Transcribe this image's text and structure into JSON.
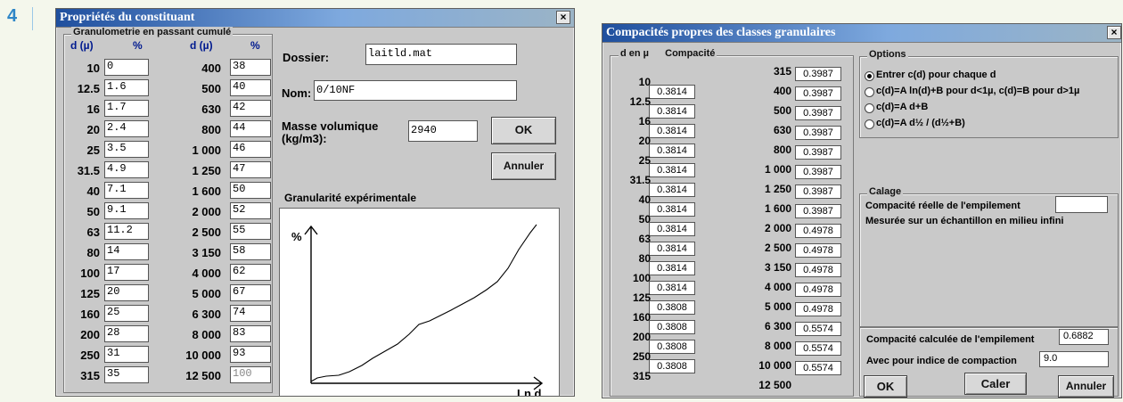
{
  "page_marker": "4",
  "left_window": {
    "title": "Propriétés du constituant",
    "close": "×",
    "group_title": "Granulometrie en passant cumulé",
    "headers": [
      "d (µ)",
      "%",
      "d (µ)",
      "%"
    ],
    "rows": [
      {
        "d1": "10",
        "p1": "0",
        "d2": "400",
        "p2": "38"
      },
      {
        "d1": "12.5",
        "p1": "1.6",
        "d2": "500",
        "p2": "40"
      },
      {
        "d1": "16",
        "p1": "1.7",
        "d2": "630",
        "p2": "42"
      },
      {
        "d1": "20",
        "p1": "2.4",
        "d2": "800",
        "p2": "44"
      },
      {
        "d1": "25",
        "p1": "3.5",
        "d2": "1 000",
        "p2": "46"
      },
      {
        "d1": "31.5",
        "p1": "4.9",
        "d2": "1 250",
        "p2": "47"
      },
      {
        "d1": "40",
        "p1": "7.1",
        "d2": "1 600",
        "p2": "50"
      },
      {
        "d1": "50",
        "p1": "9.1",
        "d2": "2 000",
        "p2": "52"
      },
      {
        "d1": "63",
        "p1": "11.2",
        "d2": "2 500",
        "p2": "55"
      },
      {
        "d1": "80",
        "p1": "14",
        "d2": "3 150",
        "p2": "58"
      },
      {
        "d1": "100",
        "p1": "17",
        "d2": "4 000",
        "p2": "62"
      },
      {
        "d1": "125",
        "p1": "20",
        "d2": "5 000",
        "p2": "67"
      },
      {
        "d1": "160",
        "p1": "25",
        "d2": "6 300",
        "p2": "74"
      },
      {
        "d1": "200",
        "p1": "28",
        "d2": "8 000",
        "p2": "83"
      },
      {
        "d1": "250",
        "p1": "31",
        "d2": "10 000",
        "p2": "93"
      },
      {
        "d1": "315",
        "p1": "35",
        "d2": "12 500",
        "p2": "100"
      }
    ],
    "folder_label": "Dossier:",
    "folder_value": "laitld.mat",
    "name_label": "Nom:",
    "name_value": "0/10NF",
    "mass_label_1": "Masse volumique",
    "mass_label_2": "(kg/m3):",
    "mass_value": "2940",
    "ok_label": "OK",
    "cancel_label": "Annuler",
    "chart_title": "Granularité expérimentale",
    "y_axis_label": "%",
    "x_axis_label": "Ln d"
  },
  "right_window": {
    "title": "Compacités propres des classes granulaires",
    "close": "×",
    "list_header_d": "d en µ",
    "list_header_c": "Compacité",
    "left_column": [
      {
        "d": "10",
        "c": "0.3814"
      },
      {
        "d": "12.5",
        "c": "0.3814"
      },
      {
        "d": "16",
        "c": "0.3814"
      },
      {
        "d": "20",
        "c": "0.3814"
      },
      {
        "d": "25",
        "c": "0.3814"
      },
      {
        "d": "31.5",
        "c": "0.3814"
      },
      {
        "d": "40",
        "c": "0.3814"
      },
      {
        "d": "50",
        "c": "0.3814"
      },
      {
        "d": "63",
        "c": "0.3814"
      },
      {
        "d": "80",
        "c": "0.3814"
      },
      {
        "d": "100",
        "c": "0.3814"
      },
      {
        "d": "125",
        "c": "0.3808"
      },
      {
        "d": "160",
        "c": "0.3808"
      },
      {
        "d": "200",
        "c": "0.3808"
      },
      {
        "d": "250",
        "c": "0.3808"
      },
      {
        "d": "315",
        "c": ""
      }
    ],
    "right_column": [
      {
        "d": "315",
        "c": "0.3987"
      },
      {
        "d": "400",
        "c": "0.3987"
      },
      {
        "d": "500",
        "c": "0.3987"
      },
      {
        "d": "630",
        "c": "0.3987"
      },
      {
        "d": "800",
        "c": "0.3987"
      },
      {
        "d": "1 000",
        "c": "0.3987"
      },
      {
        "d": "1 250",
        "c": "0.3987"
      },
      {
        "d": "1 600",
        "c": "0.3987"
      },
      {
        "d": "2 000",
        "c": "0.4978"
      },
      {
        "d": "2 500",
        "c": "0.4978"
      },
      {
        "d": "3 150",
        "c": "0.4978"
      },
      {
        "d": "4 000",
        "c": "0.4978"
      },
      {
        "d": "5 000",
        "c": "0.4978"
      },
      {
        "d": "6 300",
        "c": "0.5574"
      },
      {
        "d": "8 000",
        "c": "0.5574"
      },
      {
        "d": "10 000",
        "c": "0.5574"
      },
      {
        "d": "12 500",
        "c": ""
      }
    ],
    "options_title": "Options",
    "options": [
      "Entrer c(d) pour chaque d",
      "c(d)=A ln(d)+B pour d<1µ, c(d)=B pour d>1µ",
      "c(d)=A d+B",
      "c(d)=A d½ / (d½+B)"
    ],
    "selected_option": 0,
    "calage_title": "Calage",
    "calage_line_1": "Compacité réelle de l'empilement",
    "calage_line_2": "Mesurée sur un échantillon en milieu infini",
    "calage_value": "",
    "computed_label": "Compacité calculée de l'empilement",
    "computed_value": "0.6882",
    "index_label": "Avec pour indice de compaction",
    "index_value": "9.0",
    "ok_label": "OK",
    "caler_label": "Caler",
    "cancel_label": "Annuler"
  },
  "colors": {
    "titlebar_start": "#1f4f9e",
    "titlebar_end": "#9bb4c6",
    "window_bg": "#c9c9c9",
    "header_blue": "#001a8f",
    "page_marker": "#2e86c7"
  }
}
